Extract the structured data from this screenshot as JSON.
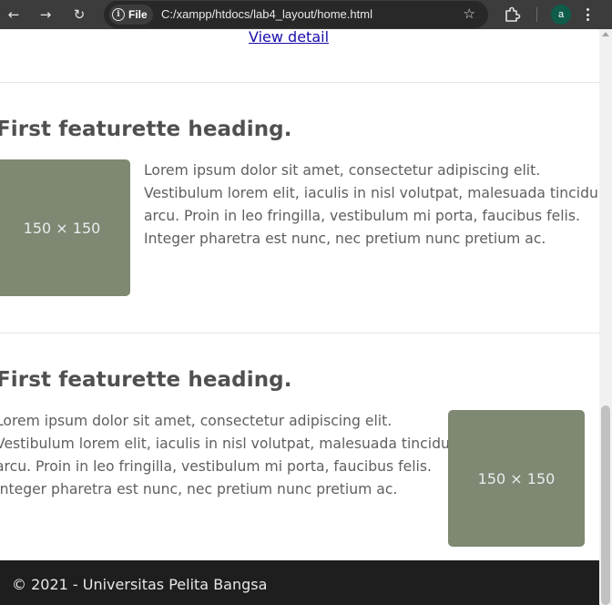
{
  "browser": {
    "back_glyph": "←",
    "forward_glyph": "→",
    "reload_glyph": "↻",
    "info_glyph": "i",
    "chip_label": "File",
    "url": "C:/xampp/htdocs/lab4_layout/home.html",
    "star_glyph": "☆",
    "avatar_letter": "a"
  },
  "page": {
    "view_link": "View detail",
    "featurettes": [
      {
        "heading": "First featurette heading.",
        "image_label": "150 × 150",
        "text_lines": [
          "Lorem ipsum dolor sit amet, consectetur adipiscing elit.",
          "Vestibulum lorem elit, iaculis in nisl volutpat, malesuada tincidunt",
          "arcu. Proin in leo fringilla, vestibulum mi porta, faucibus felis.",
          "Integer pharetra est nunc, nec pretium nunc pretium ac."
        ]
      },
      {
        "heading": "First featurette heading.",
        "image_label": "150 × 150",
        "text_lines": [
          "Lorem ipsum dolor sit amet, consectetur adipiscing elit.",
          "Vestibulum lorem elit, iaculis in nisl volutpat, malesuada tincidunt",
          "arcu. Proin in leo fringilla, vestibulum mi porta, faucibus felis.",
          "Integer pharetra est nunc, nec pretium nunc pretium ac."
        ]
      }
    ],
    "footer": "© 2021 - Universitas Pelita Bangsa"
  },
  "icons": {
    "back": "arrow-left-icon",
    "forward": "arrow-right-icon",
    "reload": "reload-icon",
    "site_info": "info-icon",
    "bookmark": "star-icon",
    "extensions": "puzzle-icon",
    "menu": "more-vertical-icon"
  },
  "colors": {
    "toolbar": "#3c3c3c",
    "omnibox": "#282828",
    "placeholder": "#7e8872",
    "heading": "#505050",
    "footer": "#1e1e1e",
    "link": "#1a0dab",
    "avatar": "#0e5c49"
  }
}
